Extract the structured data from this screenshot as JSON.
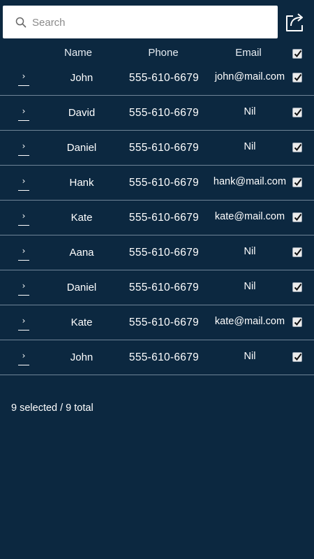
{
  "search": {
    "placeholder": "Search",
    "value": ""
  },
  "header": {
    "name": "Name",
    "phone": "Phone",
    "email": "Email",
    "select_all": true
  },
  "rows": [
    {
      "name": "John",
      "phone": "555-610-6679",
      "email": "john@mail.com",
      "checked": true
    },
    {
      "name": "David",
      "phone": "555-610-6679",
      "email": "Nil",
      "checked": true
    },
    {
      "name": "Daniel",
      "phone": "555-610-6679",
      "email": "Nil",
      "checked": true
    },
    {
      "name": "Hank",
      "phone": "555-610-6679",
      "email": "hank@mail.com",
      "checked": true
    },
    {
      "name": "Kate",
      "phone": "555-610-6679",
      "email": "kate@mail.com",
      "checked": true
    },
    {
      "name": "Aana",
      "phone": "555-610-6679",
      "email": "Nil",
      "checked": true
    },
    {
      "name": "Daniel",
      "phone": "555-610-6679",
      "email": "Nil",
      "checked": true
    },
    {
      "name": "Kate",
      "phone": "555-610-6679",
      "email": "kate@mail.com",
      "checked": true
    },
    {
      "name": "John",
      "phone": "555-610-6679",
      "email": "Nil",
      "checked": true
    }
  ],
  "footer": {
    "status": "9 selected / 9 total"
  },
  "icons": {
    "search": "search-icon",
    "share": "share-icon",
    "expand": "chevron-right-icon",
    "check": "checkmark-icon"
  },
  "colors": {
    "background": "#0c2840",
    "divider": "#6f8497",
    "text": "#ffffff"
  }
}
